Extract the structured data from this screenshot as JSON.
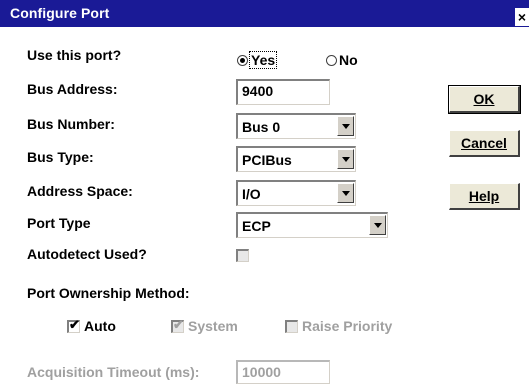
{
  "window": {
    "title": "Configure Port",
    "close_glyph": "×"
  },
  "form": {
    "use_port": {
      "label": "Use this port?",
      "options": [
        "Yes",
        "No"
      ],
      "selected": "Yes"
    },
    "bus_address": {
      "label": "Bus Address:",
      "value": "9400"
    },
    "bus_number": {
      "label": "Bus Number:",
      "value": "Bus 0"
    },
    "bus_type": {
      "label": "Bus Type:",
      "value": "PCIBus"
    },
    "address_space": {
      "label": "Address Space:",
      "value": "I/O"
    },
    "port_type": {
      "label": "Port Type",
      "value": "ECP"
    },
    "autodetect": {
      "label": "Autodetect Used?",
      "checked": false
    },
    "ownership": {
      "label": "Port Ownership Method:",
      "auto": {
        "label": "Auto",
        "checked": true
      },
      "system": {
        "label": "System",
        "checked": true
      },
      "raise_priority": {
        "label": "Raise Priority",
        "checked": false
      }
    },
    "acquisition_timeout": {
      "label": "Acquisition Timeout (ms):",
      "value": "10000"
    }
  },
  "buttons": {
    "ok": "OK",
    "cancel": "Cancel",
    "help": "Help"
  }
}
